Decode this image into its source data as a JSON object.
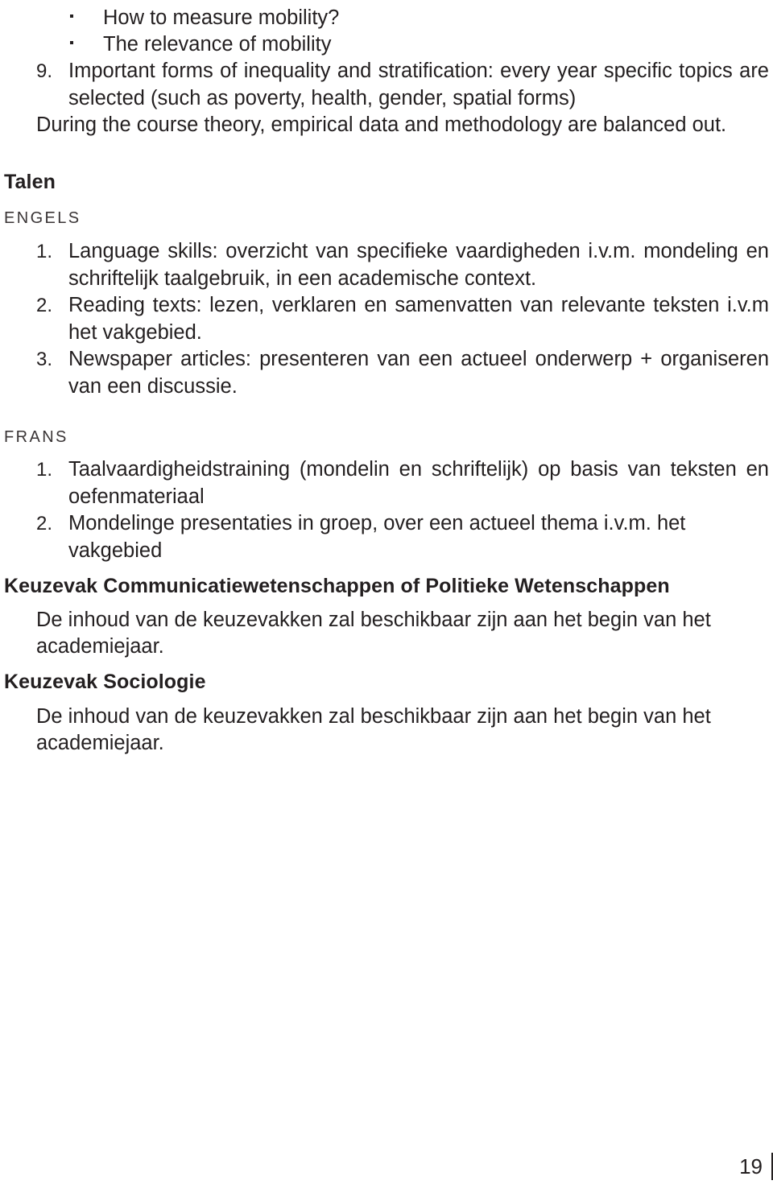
{
  "document": {
    "page_number": "19",
    "text_color": "#231f20",
    "background_color": "#ffffff"
  },
  "top_bullets": [
    {
      "marker": "·",
      "text": "How to measure mobility?"
    },
    {
      "marker": "·",
      "text": "The relevance of mobility"
    }
  ],
  "item_nine": {
    "marker": "9.",
    "text": "Important forms of inequality and stratification: every year specific topics are selected (such as poverty, health, gender, spatial forms)"
  },
  "closing_note": "During the course theory, empirical data and methodology are balanced out.",
  "talen": {
    "heading": "Talen",
    "engels": {
      "label": "ENGELS",
      "items": [
        {
          "marker": "1.",
          "text": "Language skills: overzicht van specifieke vaardigheden i.v.m. mondeling en schriftelijk taalgebruik, in een academische context."
        },
        {
          "marker": "2.",
          "text": "Reading texts: lezen, verklaren en samenvatten van relevante teksten i.v.m het vakgebied."
        },
        {
          "marker": "3.",
          "text": "Newspaper articles: presenteren van een actueel onderwerp + organiseren van een discussie."
        }
      ]
    },
    "frans": {
      "label": "FRANS",
      "items": [
        {
          "marker": "1.",
          "text": "Taalvaardigheidstraining (mondelin en schriftelijk) op basis van teksten en oefenmateriaal"
        },
        {
          "marker": "2.",
          "text": "Mondelinge presentaties in groep, over een actueel thema i.v.m. het vakgebied"
        }
      ]
    }
  },
  "keuzevakken": [
    {
      "heading": "Keuzevak Communicatiewetenschappen of Politieke Wetenschappen",
      "body": "De inhoud van de keuzevakken zal beschikbaar zijn aan het begin van het academiejaar."
    },
    {
      "heading": "Keuzevak Sociologie",
      "body": "De inhoud van de keuzevakken zal beschikbaar zijn aan het begin van het academiejaar."
    }
  ]
}
